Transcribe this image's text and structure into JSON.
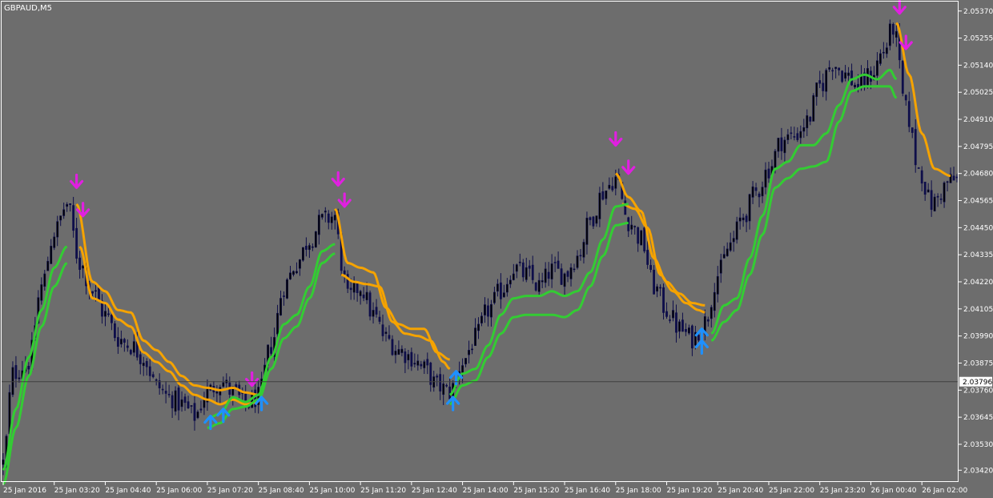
{
  "window": {
    "symbol_label": "GBPAUD,M5",
    "colors": {
      "background": "#6d6d6d",
      "frame": "#ffffff",
      "candle": "#0e0e4a",
      "orange_band": "#f5a300",
      "green_band": "#33cc33",
      "sell_arrow": "#e020e0",
      "buy_arrow": "#1e90ff",
      "price_line": "#404040",
      "price_box_bg": "#ffffff",
      "price_box_text": "#000000"
    }
  },
  "chart_data": {
    "type": "candlestick",
    "symbol": "GBPAUD",
    "timeframe": "M5",
    "bar_count": 240,
    "y_range": [
      2.0337,
      2.0541
    ],
    "x_tick_labels": [
      {
        "bar": 0,
        "label": "25 Jan 2016"
      },
      {
        "bar": 16,
        "label": "25 Jan 03:20"
      },
      {
        "bar": 32,
        "label": "25 Jan 04:40"
      },
      {
        "bar": 48,
        "label": "25 Jan 06:00"
      },
      {
        "bar": 64,
        "label": "25 Jan 07:20"
      },
      {
        "bar": 80,
        "label": "25 Jan 08:40"
      },
      {
        "bar": 96,
        "label": "25 Jan 10:00"
      },
      {
        "bar": 112,
        "label": "25 Jan 11:20"
      },
      {
        "bar": 128,
        "label": "25 Jan 12:40"
      },
      {
        "bar": 144,
        "label": "25 Jan 14:00"
      },
      {
        "bar": 160,
        "label": "25 Jan 15:20"
      },
      {
        "bar": 176,
        "label": "25 Jan 16:40"
      },
      {
        "bar": 192,
        "label": "25 Jan 18:00"
      },
      {
        "bar": 208,
        "label": "25 Jan 19:20"
      },
      {
        "bar": 224,
        "label": "25 Jan 20:40"
      },
      {
        "bar": 240,
        "label": "25 Jan 22:00"
      },
      {
        "bar": 256,
        "label": "25 Jan 23:20"
      },
      {
        "bar": 272,
        "label": "26 Jan 00:40"
      },
      {
        "bar": 288,
        "label": "26 Jan 02:00"
      }
    ],
    "x_tick_bars_visible": [
      0,
      16,
      32,
      48,
      64,
      80,
      96,
      112,
      128,
      144,
      160,
      176,
      192,
      208,
      224,
      240,
      256,
      272,
      288
    ],
    "y_ticks": [
      "2.05370",
      "2.05255",
      "2.05140",
      "2.05025",
      "2.04910",
      "2.04795",
      "2.04680",
      "2.04565",
      "2.04450",
      "2.04335",
      "2.04220",
      "2.04105",
      "2.03990",
      "2.03875",
      "2.03760",
      "2.03645",
      "2.03530",
      "2.03420"
    ],
    "current_price": "2.03796",
    "close_anchors": [
      [
        0,
        2.0345
      ],
      [
        3,
        2.0383
      ],
      [
        8,
        2.0388
      ],
      [
        12,
        2.042
      ],
      [
        16,
        2.0443
      ],
      [
        20,
        2.0455
      ],
      [
        24,
        2.043
      ],
      [
        28,
        2.0418
      ],
      [
        32,
        2.0408
      ],
      [
        36,
        2.0398
      ],
      [
        40,
        2.0395
      ],
      [
        44,
        2.039
      ],
      [
        48,
        2.0378
      ],
      [
        52,
        2.0373
      ],
      [
        56,
        2.037
      ],
      [
        60,
        2.0365
      ],
      [
        64,
        2.0375
      ],
      [
        68,
        2.038
      ],
      [
        72,
        2.0375
      ],
      [
        76,
        2.037
      ],
      [
        80,
        2.0373
      ],
      [
        84,
        2.0395
      ],
      [
        88,
        2.042
      ],
      [
        92,
        2.043
      ],
      [
        96,
        2.044
      ],
      [
        100,
        2.0448
      ],
      [
        104,
        2.045
      ],
      [
        106,
        2.043
      ],
      [
        108,
        2.0415
      ],
      [
        112,
        2.042
      ],
      [
        116,
        2.0408
      ],
      [
        120,
        2.0398
      ],
      [
        124,
        2.0393
      ],
      [
        128,
        2.039
      ],
      [
        132,
        2.0385
      ],
      [
        136,
        2.0378
      ],
      [
        140,
        2.0375
      ],
      [
        144,
        2.0388
      ],
      [
        148,
        2.0398
      ],
      [
        152,
        2.041
      ],
      [
        156,
        2.0418
      ],
      [
        160,
        2.0428
      ],
      [
        164,
        2.0425
      ],
      [
        168,
        2.042
      ],
      [
        172,
        2.0427
      ],
      [
        176,
        2.0425
      ],
      [
        180,
        2.0433
      ],
      [
        184,
        2.0448
      ],
      [
        188,
        2.046
      ],
      [
        192,
        2.0466
      ],
      [
        196,
        2.0448
      ],
      [
        200,
        2.044
      ],
      [
        204,
        2.042
      ],
      [
        208,
        2.041
      ],
      [
        212,
        2.0402
      ],
      [
        216,
        2.0398
      ],
      [
        220,
        2.0405
      ],
      [
        224,
        2.0425
      ],
      [
        228,
        2.0438
      ],
      [
        232,
        2.045
      ],
      [
        236,
        2.046
      ],
      [
        240,
        2.047
      ],
      [
        244,
        2.0482
      ],
      [
        248,
        2.0484
      ],
      [
        252,
        2.049
      ],
      [
        256,
        2.0505
      ],
      [
        260,
        2.0515
      ],
      [
        264,
        2.051
      ],
      [
        268,
        2.0505
      ],
      [
        272,
        2.051
      ],
      [
        276,
        2.052
      ],
      [
        279,
        2.053
      ],
      [
        283,
        2.0495
      ],
      [
        287,
        2.047
      ],
      [
        291,
        2.0455
      ],
      [
        297,
        2.0465
      ]
    ],
    "bands": {
      "orange_upper": [
        [
          23,
          2.0455
        ],
        [
          28,
          2.0422
        ],
        [
          32,
          2.0418
        ],
        [
          36,
          2.041
        ],
        [
          40,
          2.0409
        ],
        [
          44,
          2.0397
        ],
        [
          48,
          2.0393
        ],
        [
          52,
          2.0388
        ],
        [
          56,
          2.0382
        ],
        [
          60,
          2.0378
        ],
        [
          64,
          2.0377
        ],
        [
          68,
          2.0376
        ],
        [
          72,
          2.0377
        ],
        [
          76,
          2.0375
        ],
        [
          80,
          2.0374
        ],
        [
          104,
          2.0453
        ],
        [
          108,
          2.043
        ],
        [
          112,
          2.0428
        ],
        [
          116,
          2.0426
        ],
        [
          120,
          2.0411
        ],
        [
          124,
          2.0404
        ],
        [
          128,
          2.0402
        ],
        [
          132,
          2.0402
        ],
        [
          136,
          2.0392
        ],
        [
          140,
          2.0389
        ],
        [
          192,
          2.0468
        ],
        [
          196,
          2.0458
        ],
        [
          200,
          2.0452
        ],
        [
          204,
          2.0432
        ],
        [
          208,
          2.0422
        ],
        [
          212,
          2.0417
        ],
        [
          216,
          2.0413
        ],
        [
          220,
          2.0412
        ],
        [
          280,
          2.0532
        ],
        [
          284,
          2.051
        ],
        [
          288,
          2.0485
        ],
        [
          292,
          2.047
        ],
        [
          297,
          2.0467
        ]
      ],
      "orange_lower": [
        [
          24,
          2.0437
        ],
        [
          28,
          2.0415
        ],
        [
          32,
          2.0413
        ],
        [
          36,
          2.0406
        ],
        [
          40,
          2.0403
        ],
        [
          44,
          2.0392
        ],
        [
          48,
          2.0388
        ],
        [
          52,
          2.0384
        ],
        [
          56,
          2.0378
        ],
        [
          60,
          2.0374
        ],
        [
          64,
          2.0372
        ],
        [
          68,
          2.037
        ],
        [
          72,
          2.0372
        ],
        [
          76,
          2.037
        ],
        [
          80,
          2.0371
        ],
        [
          106,
          2.0425
        ],
        [
          110,
          2.0422
        ],
        [
          114,
          2.0421
        ],
        [
          118,
          2.042
        ],
        [
          122,
          2.0405
        ],
        [
          126,
          2.04
        ],
        [
          130,
          2.0399
        ],
        [
          134,
          2.0397
        ],
        [
          138,
          2.0388
        ],
        [
          140,
          2.0385
        ],
        [
          194,
          2.0455
        ],
        [
          198,
          2.0453
        ],
        [
          202,
          2.0445
        ],
        [
          206,
          2.0425
        ],
        [
          210,
          2.0418
        ],
        [
          214,
          2.0413
        ],
        [
          218,
          2.041
        ],
        [
          220,
          2.0409
        ]
      ],
      "green_upper": [
        [
          0,
          2.0342
        ],
        [
          4,
          2.0368
        ],
        [
          8,
          2.039
        ],
        [
          12,
          2.041
        ],
        [
          16,
          2.0428
        ],
        [
          20,
          2.0437
        ],
        [
          64,
          2.0364
        ],
        [
          68,
          2.0366
        ],
        [
          72,
          2.0373
        ],
        [
          76,
          2.0371
        ],
        [
          80,
          2.0374
        ],
        [
          84,
          2.039
        ],
        [
          88,
          2.0404
        ],
        [
          92,
          2.0408
        ],
        [
          96,
          2.042
        ],
        [
          100,
          2.0435
        ],
        [
          104,
          2.0438
        ],
        [
          140,
          2.0374
        ],
        [
          144,
          2.0383
        ],
        [
          148,
          2.0385
        ],
        [
          152,
          2.0395
        ],
        [
          156,
          2.0408
        ],
        [
          160,
          2.0415
        ],
        [
          164,
          2.0416
        ],
        [
          168,
          2.0416
        ],
        [
          172,
          2.0418
        ],
        [
          176,
          2.0416
        ],
        [
          180,
          2.0418
        ],
        [
          184,
          2.0426
        ],
        [
          188,
          2.044
        ],
        [
          192,
          2.0454
        ],
        [
          196,
          2.0455
        ],
        [
          222,
          2.04
        ],
        [
          226,
          2.0412
        ],
        [
          230,
          2.0415
        ],
        [
          234,
          2.0432
        ],
        [
          238,
          2.045
        ],
        [
          242,
          2.047
        ],
        [
          246,
          2.0473
        ],
        [
          250,
          2.048
        ],
        [
          254,
          2.048
        ],
        [
          258,
          2.0485
        ],
        [
          262,
          2.0497
        ],
        [
          266,
          2.0508
        ],
        [
          270,
          2.051
        ],
        [
          274,
          2.0508
        ],
        [
          278,
          2.0512
        ],
        [
          280,
          2.0508
        ]
      ],
      "green_lower": [
        [
          0,
          2.0336
        ],
        [
          4,
          2.036
        ],
        [
          8,
          2.0382
        ],
        [
          12,
          2.0403
        ],
        [
          16,
          2.042
        ],
        [
          20,
          2.043
        ],
        [
          64,
          2.036
        ],
        [
          68,
          2.0362
        ],
        [
          72,
          2.0368
        ],
        [
          76,
          2.0369
        ],
        [
          80,
          2.0372
        ],
        [
          84,
          2.0385
        ],
        [
          88,
          2.0398
        ],
        [
          92,
          2.0403
        ],
        [
          96,
          2.0415
        ],
        [
          100,
          2.043
        ],
        [
          104,
          2.0434
        ],
        [
          140,
          2.037
        ],
        [
          144,
          2.0378
        ],
        [
          148,
          2.038
        ],
        [
          152,
          2.039
        ],
        [
          156,
          2.04
        ],
        [
          160,
          2.0407
        ],
        [
          164,
          2.0408
        ],
        [
          168,
          2.0408
        ],
        [
          172,
          2.0408
        ],
        [
          176,
          2.0407
        ],
        [
          180,
          2.041
        ],
        [
          184,
          2.042
        ],
        [
          188,
          2.0433
        ],
        [
          192,
          2.0446
        ],
        [
          196,
          2.0447
        ],
        [
          222,
          2.0397
        ],
        [
          226,
          2.0405
        ],
        [
          230,
          2.041
        ],
        [
          234,
          2.0425
        ],
        [
          238,
          2.0442
        ],
        [
          242,
          2.0462
        ],
        [
          246,
          2.0466
        ],
        [
          250,
          2.047
        ],
        [
          254,
          2.0471
        ],
        [
          258,
          2.0473
        ],
        [
          262,
          2.049
        ],
        [
          266,
          2.0503
        ],
        [
          270,
          2.0505
        ],
        [
          274,
          2.0505
        ],
        [
          278,
          2.0505
        ],
        [
          280,
          2.05
        ]
      ]
    },
    "sell_signals": [
      {
        "bar": 23,
        "price": 2.0464
      },
      {
        "bar": 25,
        "price": 2.0452
      },
      {
        "bar": 78,
        "price": 2.038
      },
      {
        "bar": 105,
        "price": 2.0465
      },
      {
        "bar": 107,
        "price": 2.0456
      },
      {
        "bar": 192,
        "price": 2.0482
      },
      {
        "bar": 196,
        "price": 2.047
      },
      {
        "bar": 281,
        "price": 2.0538
      },
      {
        "bar": 283,
        "price": 2.0523
      }
    ],
    "buy_signals": [
      {
        "bar": 65,
        "price": 2.0363
      },
      {
        "bar": 69,
        "price": 2.0366
      },
      {
        "bar": 81,
        "price": 2.0371
      },
      {
        "bar": 141,
        "price": 2.0371
      },
      {
        "bar": 142,
        "price": 2.0382
      },
      {
        "bar": 219,
        "price": 2.0395
      },
      {
        "bar": 219,
        "price": 2.04
      }
    ]
  }
}
